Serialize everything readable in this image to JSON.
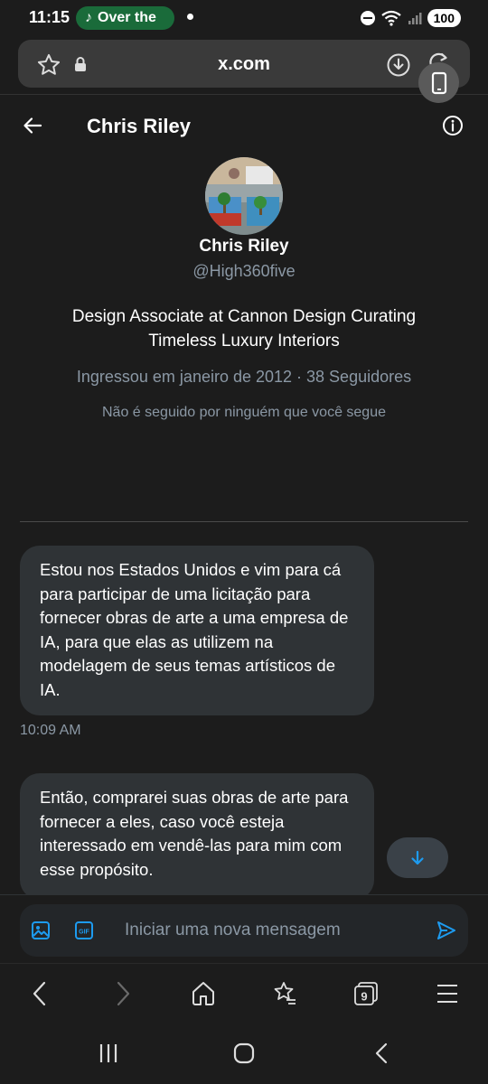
{
  "status_bar": {
    "time": "11:15",
    "music_label": "Over the",
    "battery": "100"
  },
  "browser": {
    "url": "x.com"
  },
  "header": {
    "title": "Chris Riley"
  },
  "profile": {
    "name": "Chris Riley",
    "handle": "@High360five",
    "bio": "Design Associate at Cannon Design Curating Timeless Luxury Interiors",
    "meta": "Ingressou em janeiro de 2012 · 38 Seguidores",
    "mutual": "Não é seguido por ninguém que você segue"
  },
  "messages": [
    {
      "text": "Estou nos Estados Unidos e vim para cá para participar de uma licitação para fornecer obras de arte a uma empresa de IA, para que elas as utilizem na modelagem de seus temas artísticos de IA.",
      "time": "10:09 AM"
    },
    {
      "text": "Então, comprarei suas obras de arte para fornecer a eles, caso você esteja interessado em vendê-las para mim com esse propósito."
    }
  ],
  "composer": {
    "placeholder": "Iniciar uma nova mensagem",
    "gif_label": "GIF"
  },
  "browser_nav": {
    "tab_count": "9"
  },
  "colors": {
    "background": "#1c1c1c",
    "bubble": "#2f3336",
    "accent": "#1d9bf0",
    "muted_text": "#8b98a5",
    "music_pill": "#1a6b3a"
  }
}
